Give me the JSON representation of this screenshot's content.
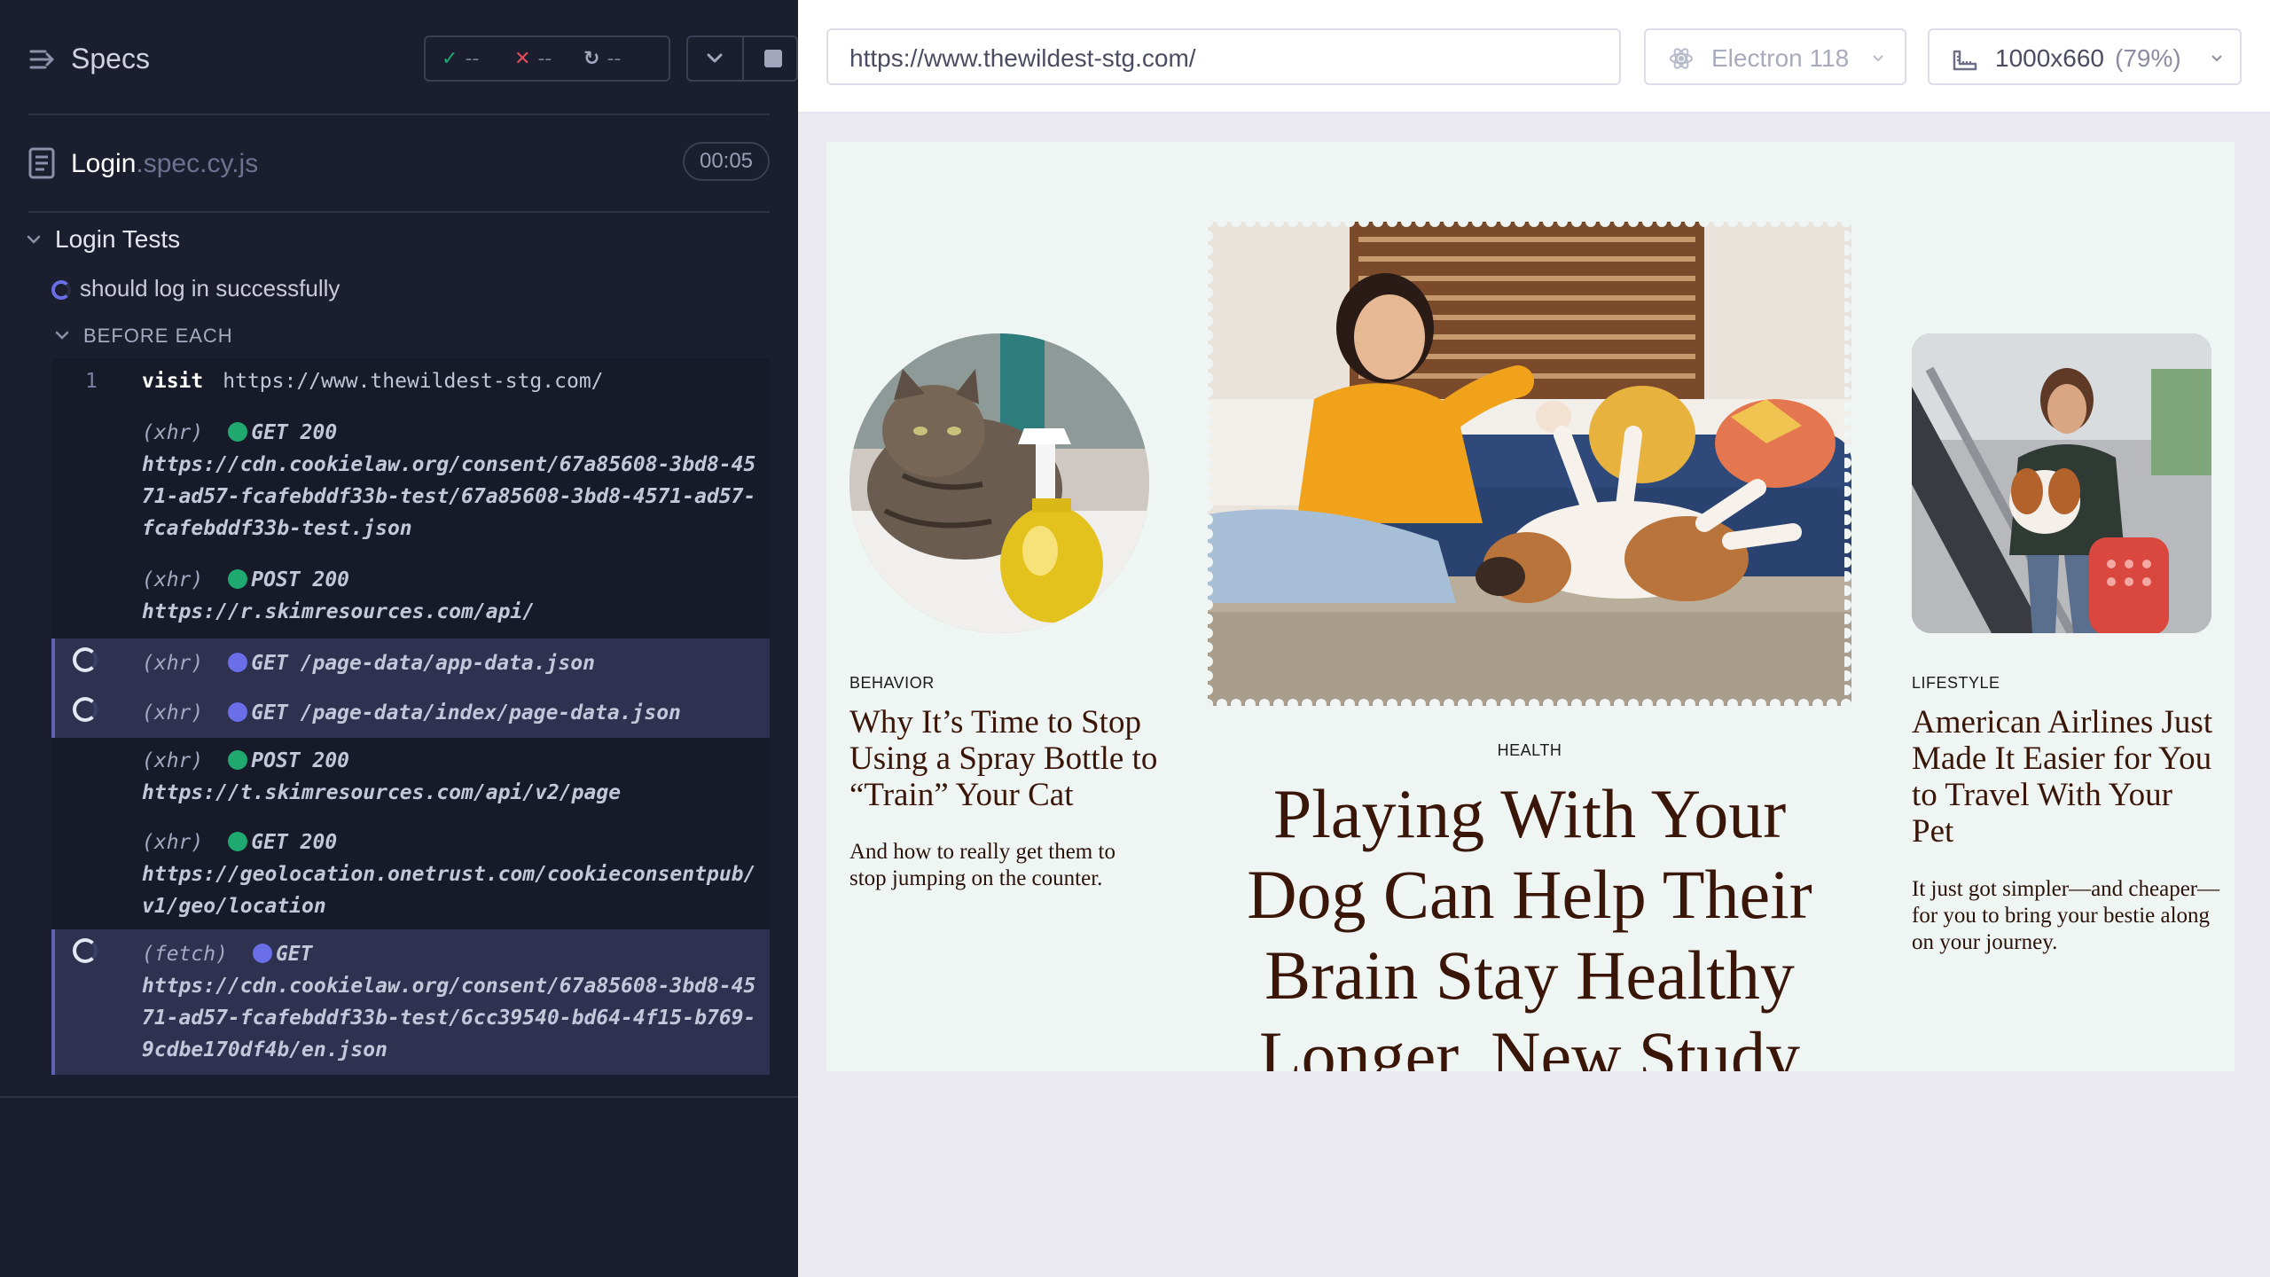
{
  "reporter": {
    "specs_title": "Specs",
    "stats": {
      "passed": "--",
      "failed": "--",
      "pending": "--"
    },
    "spec_file": {
      "name": "Login",
      "ext": ".spec.cy.js",
      "duration": "00:05"
    },
    "suite_title": "Login Tests",
    "test_title": "should log in successfully",
    "hook_title": "BEFORE EACH",
    "commands": [
      {
        "num": "1",
        "name": "visit",
        "message": "https://www.thewildest-stg.com/"
      },
      {
        "type": "(xhr)",
        "status_color": "green",
        "method": "GET 200",
        "url": "https://cdn.cookielaw.org/consent/67a85608-3bd8-4571-ad57-fcafebddf33b-test/67a85608-3bd8-4571-ad57-fcafebddf33b-test.json"
      },
      {
        "type": "(xhr)",
        "status_color": "green",
        "method": "POST 200",
        "url": "https://r.skimresources.com/api/"
      },
      {
        "type": "(xhr)",
        "status_color": "blue",
        "method": "GET /page-data/app-data.json",
        "pending": true
      },
      {
        "type": "(xhr)",
        "status_color": "blue",
        "method": "GET /page-data/index/page-data.json",
        "pending": true
      },
      {
        "type": "(xhr)",
        "status_color": "green",
        "method": "POST 200",
        "url": "https://t.skimresources.com/api/v2/page"
      },
      {
        "type": "(xhr)",
        "status_color": "green",
        "method": "GET 200",
        "url": "https://geolocation.onetrust.com/cookieconsentpub/v1/geo/location"
      },
      {
        "type": "(fetch)",
        "status_color": "blue",
        "method": "GET",
        "url": "https://cdn.cookielaw.org/consent/67a85608-3bd8-4571-ad57-fcafebddf33b-test/6cc39540-bd64-4f15-b769-9cdbe170df4b/en.json",
        "pending": true
      }
    ]
  },
  "aut": {
    "url": "https://www.thewildest-stg.com/",
    "browser": "Electron 118",
    "viewport": "1000x660",
    "scale": "(79%)"
  },
  "site": {
    "left": {
      "category": "BEHAVIOR",
      "title": "Why It’s Time to Stop Using a Spray Bottle to “Train” Your Cat",
      "dek": "And how to really get them to stop jumping on the counter."
    },
    "main": {
      "category": "HEALTH",
      "title": "Playing With Your Dog Can Help Their Brain Stay Healthy Longer, New Study"
    },
    "right": {
      "category": "LIFESTYLE",
      "title": "American Airlines Just Made It Easier for You to Travel With Your Pet",
      "dek": "It just got simpler—and cheaper—for you to bring your bestie along on your journey."
    }
  },
  "colors": {
    "reporter_bg": "#1b1e2e",
    "passed": "#1fa971",
    "failed": "#e24c5b",
    "pending": "#6a6fe8",
    "site_bg": "#eef5f3",
    "headline": "#3a1608"
  },
  "icons": [
    "specs-icon",
    "check-icon",
    "x-icon",
    "spinner-icon",
    "chevron-down-icon",
    "stop-icon",
    "file-icon",
    "electron-icon",
    "viewport-ruler-icon"
  ]
}
